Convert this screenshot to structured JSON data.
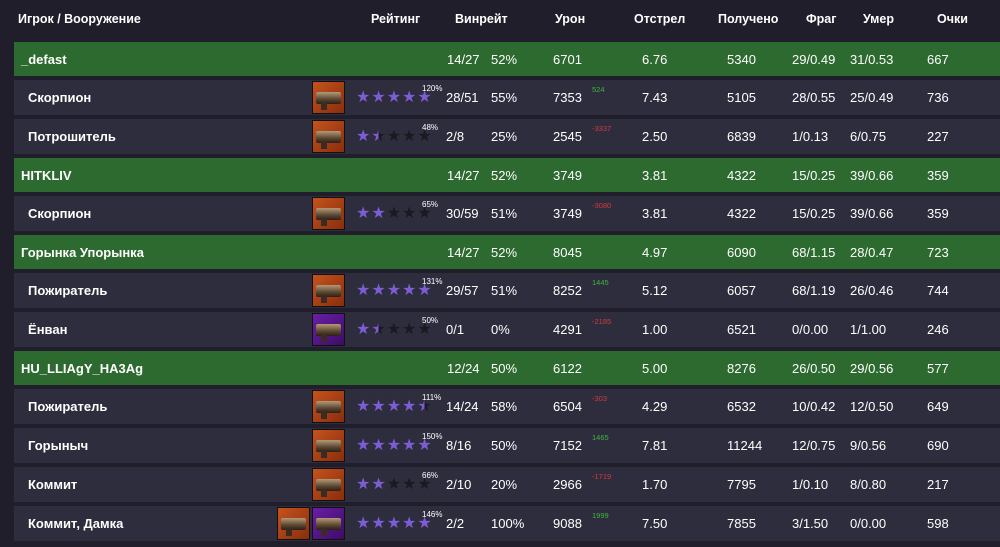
{
  "colors": {
    "background": "#1f1e2a",
    "player_row": "#2d6a2f",
    "weapon_row": "#2e2d3d",
    "star_filled": "#7d5cd6",
    "star_empty": "#1a1922",
    "delta_positive": "#3fb43f",
    "delta_negative": "#d23b3b"
  },
  "header": {
    "player": "Игрок / Вооружение",
    "rating": "Рейтинг",
    "winrate": "Винрейт",
    "damage": "Урон",
    "shot": "Отстрел",
    "received": "Получено",
    "frag": "Фраг",
    "died": "Умер",
    "score": "Очки"
  },
  "rows": [
    {
      "type": "player",
      "name": "_defast",
      "wins": "14/27",
      "winpct": "52%",
      "damage": "6701",
      "shot": "6.76",
      "received": "5340",
      "frag": "29/0.49",
      "died": "31/0.53",
      "score": "667"
    },
    {
      "type": "weapon",
      "name": "Скорпион",
      "icons": [
        {
          "name": "scorpion-icon",
          "bg": "orange"
        }
      ],
      "stars": 5,
      "rating_pct": "120%",
      "wins": "28/51",
      "winpct": "55%",
      "damage": "7353",
      "delta": "524",
      "delta_sign": "pos",
      "shot": "7.43",
      "received": "5105",
      "frag": "28/0.55",
      "died": "25/0.49",
      "score": "736"
    },
    {
      "type": "weapon",
      "name": "Потрошитель",
      "icons": [
        {
          "name": "ripper-icon",
          "bg": "orange"
        }
      ],
      "stars": 1.5,
      "rating_pct": "48%",
      "wins": "2/8",
      "winpct": "25%",
      "damage": "2545",
      "delta": "-3337",
      "delta_sign": "neg",
      "shot": "2.50",
      "received": "6839",
      "frag": "1/0.13",
      "died": "6/0.75",
      "score": "227"
    },
    {
      "type": "player",
      "name": "HITKLIV",
      "wins": "14/27",
      "winpct": "52%",
      "damage": "3749",
      "shot": "3.81",
      "received": "4322",
      "frag": "15/0.25",
      "died": "39/0.66",
      "score": "359"
    },
    {
      "type": "weapon",
      "name": "Скорпион",
      "icons": [
        {
          "name": "scorpion-icon",
          "bg": "orange"
        }
      ],
      "stars": 2,
      "rating_pct": "65%",
      "wins": "30/59",
      "winpct": "51%",
      "damage": "3749",
      "delta": "-3080",
      "delta_sign": "neg",
      "shot": "3.81",
      "received": "4322",
      "frag": "15/0.25",
      "died": "39/0.66",
      "score": "359"
    },
    {
      "type": "player",
      "name": "Горынка Упорынка",
      "wins": "14/27",
      "winpct": "52%",
      "damage": "8045",
      "shot": "4.97",
      "received": "6090",
      "frag": "68/1.15",
      "died": "28/0.47",
      "score": "723"
    },
    {
      "type": "weapon",
      "name": "Пожиратель",
      "icons": [
        {
          "name": "devourer-icon",
          "bg": "orange"
        }
      ],
      "stars": 5,
      "rating_pct": "131%",
      "wins": "29/57",
      "winpct": "51%",
      "damage": "8252",
      "delta": "1445",
      "delta_sign": "pos",
      "shot": "5.12",
      "received": "6057",
      "frag": "68/1.19",
      "died": "26/0.46",
      "score": "744"
    },
    {
      "type": "weapon",
      "name": "Ёнван",
      "icons": [
        {
          "name": "yongwan-icon",
          "bg": "purple"
        }
      ],
      "stars": 1.5,
      "rating_pct": "50%",
      "wins": "0/1",
      "winpct": "0%",
      "damage": "4291",
      "delta": "-2185",
      "delta_sign": "neg",
      "shot": "1.00",
      "received": "6521",
      "frag": "0/0.00",
      "died": "1/1.00",
      "score": "246"
    },
    {
      "type": "player",
      "name": "HU_LLIAgY_HA3Ag",
      "wins": "12/24",
      "winpct": "50%",
      "damage": "6122",
      "shot": "5.00",
      "received": "8276",
      "frag": "26/0.50",
      "died": "29/0.56",
      "score": "577"
    },
    {
      "type": "weapon",
      "name": "Пожиратель",
      "icons": [
        {
          "name": "devourer-icon",
          "bg": "orange"
        }
      ],
      "stars": 4.5,
      "rating_pct": "111%",
      "wins": "14/24",
      "winpct": "58%",
      "damage": "6504",
      "delta": "-303",
      "delta_sign": "neg",
      "shot": "4.29",
      "received": "6532",
      "frag": "10/0.42",
      "died": "12/0.50",
      "score": "649"
    },
    {
      "type": "weapon",
      "name": "Горыныч",
      "icons": [
        {
          "name": "gorynych-icon",
          "bg": "orange"
        }
      ],
      "stars": 5,
      "rating_pct": "150%",
      "wins": "8/16",
      "winpct": "50%",
      "damage": "7152",
      "delta": "1465",
      "delta_sign": "pos",
      "shot": "7.81",
      "received": "11244",
      "frag": "12/0.75",
      "died": "9/0.56",
      "score": "690"
    },
    {
      "type": "weapon",
      "name": "Коммит",
      "icons": [
        {
          "name": "commit-icon",
          "bg": "orange"
        }
      ],
      "stars": 2,
      "rating_pct": "66%",
      "wins": "2/10",
      "winpct": "20%",
      "damage": "2966",
      "delta": "-1719",
      "delta_sign": "neg",
      "shot": "1.70",
      "received": "7795",
      "frag": "1/0.10",
      "died": "8/0.80",
      "score": "217"
    },
    {
      "type": "weapon",
      "name": "Коммит, Дамка",
      "icons": [
        {
          "name": "commit-icon",
          "bg": "orange"
        },
        {
          "name": "damka-icon",
          "bg": "purple"
        }
      ],
      "stars": 5,
      "rating_pct": "146%",
      "wins": "2/2",
      "winpct": "100%",
      "damage": "9088",
      "delta": "1999",
      "delta_sign": "pos",
      "shot": "7.50",
      "received": "7855",
      "frag": "3/1.50",
      "died": "0/0.00",
      "score": "598"
    }
  ]
}
